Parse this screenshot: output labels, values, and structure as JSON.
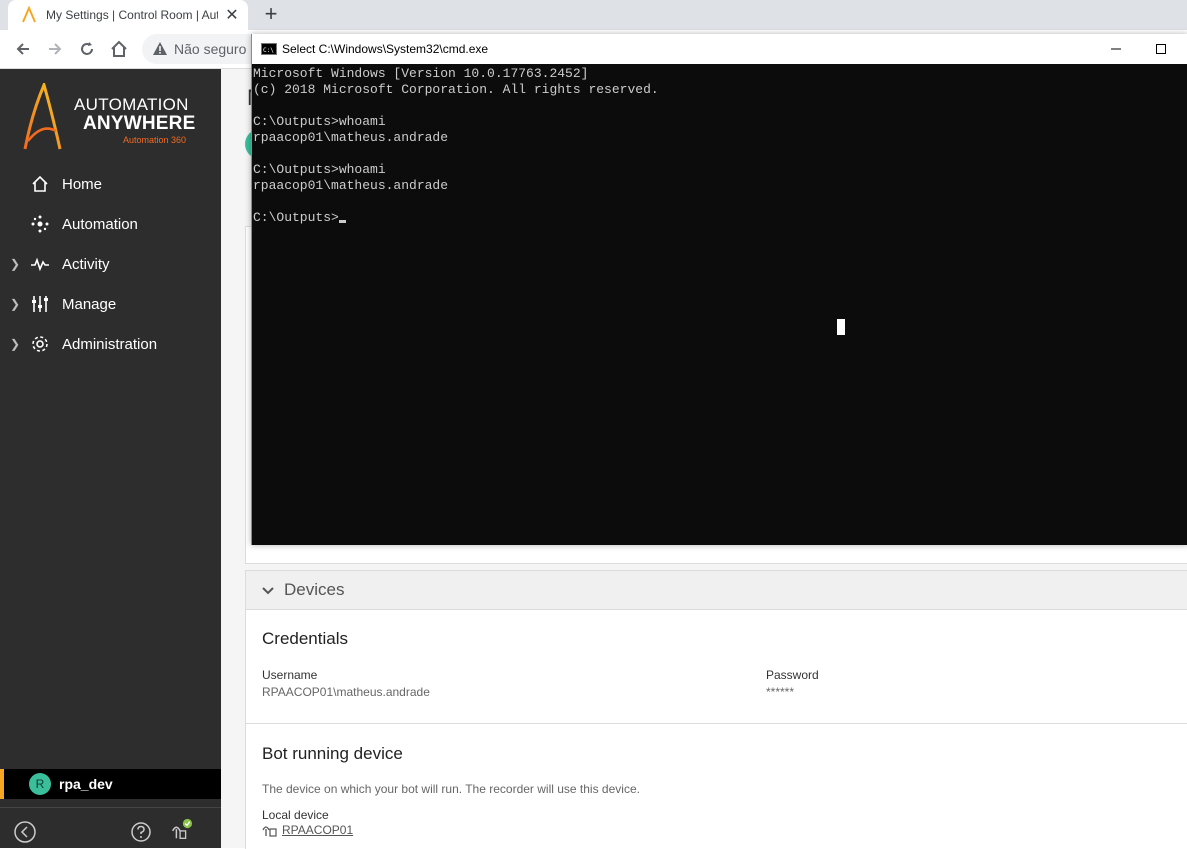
{
  "browser": {
    "tab_title": "My Settings | Control Room | Automation Anywhere",
    "tab_close": "✕",
    "new_tab": "+",
    "security_text": "Não seguro"
  },
  "cmd": {
    "title": "Select C:\\Windows\\System32\\cmd.exe",
    "lines": [
      "Microsoft Windows [Version 10.0.17763.2452]",
      "(c) 2018 Microsoft Corporation. All rights reserved.",
      "",
      "C:\\Outputs>whoami",
      "rpaacop01\\matheus.andrade",
      "",
      "C:\\Outputs>whoami",
      "rpaacop01\\matheus.andrade",
      "",
      "C:\\Outputs>"
    ]
  },
  "sidebar": {
    "logo_line1": "AUTOMATION",
    "logo_line2": "ANYWHERE",
    "logo_line3": "Automation 360",
    "items": [
      {
        "label": "Home",
        "icon": "home-icon"
      },
      {
        "label": "Automation",
        "icon": "automation-icon"
      },
      {
        "label": "Activity",
        "icon": "activity-icon"
      },
      {
        "label": "Manage",
        "icon": "manage-icon"
      },
      {
        "label": "Administration",
        "icon": "gear-icon"
      }
    ],
    "user_initial": "R",
    "user_name": "rpa_dev"
  },
  "main": {
    "page_title_peek": "M",
    "devices": {
      "header": "Devices",
      "credentials_title": "Credentials",
      "username_label": "Username",
      "username_value": "RPAACOP01\\matheus.andrade",
      "password_label": "Password",
      "password_value": "******",
      "bot_device_title": "Bot running device",
      "bot_device_desc": "The device on which your bot will run. The recorder will use this device.",
      "local_device_label": "Local device",
      "local_device_value": "RPAACOP01"
    }
  },
  "colors": {
    "sidebar_bg": "#2d2d2d",
    "brand_orange": "#f26b21",
    "accent_yellow": "#f7a823",
    "avatar_teal": "#3bbf9a",
    "console_bg": "#0c0c0c"
  }
}
